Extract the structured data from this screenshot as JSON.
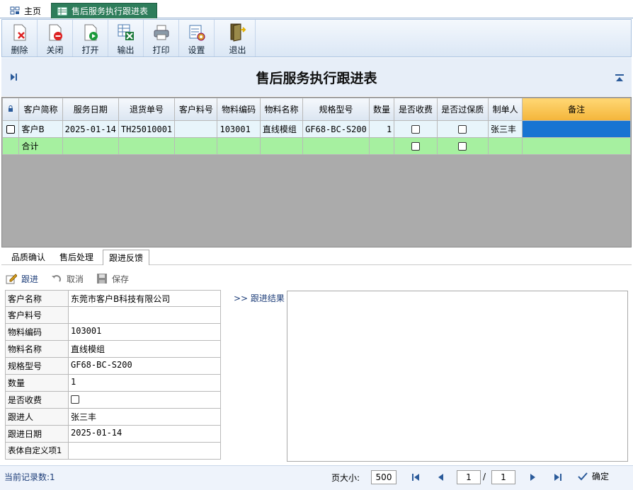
{
  "doc_tabs": {
    "home": "主页",
    "active": "售后服务执行跟进表"
  },
  "toolbar": {
    "delete": "删除",
    "close": "关闭",
    "open": "打开",
    "export": "输出",
    "print": "打印",
    "settings": "设置",
    "exit": "退出"
  },
  "report": {
    "title": "售后服务执行跟进表"
  },
  "grid": {
    "columns": [
      "客户简称",
      "服务日期",
      "退货单号",
      "客户料号",
      "物料编码",
      "物料名称",
      "规格型号",
      "数量",
      "是否收费",
      "是否过保质",
      "制单人",
      "备注"
    ],
    "row": {
      "customer": "客户B",
      "service_date": "2025-01-14",
      "return_no": "TH25010001",
      "customer_part": "",
      "material_code": "103001",
      "material_name": "直线模组",
      "spec": "GF68-BC-S200",
      "qty": "1",
      "maker": "张三丰",
      "remark": ""
    },
    "total_label": "合计"
  },
  "bottom_tabs": [
    "品质确认",
    "售后处理",
    "跟进反馈"
  ],
  "actions": {
    "follow": "跟进",
    "cancel": "取消",
    "save": "保存"
  },
  "form": {
    "customer_name_label": "客户名称",
    "customer_name": "东莞市客户B科技有限公司",
    "customer_part_label": "客户料号",
    "customer_part": "",
    "material_code_label": "物料编码",
    "material_code": "103001",
    "material_name_label": "物料名称",
    "material_name": "直线模组",
    "spec_label": "规格型号",
    "spec": "GF68-BC-S200",
    "qty_label": "数量",
    "qty": "1",
    "charge_label": "是否收费",
    "follower_label": "跟进人",
    "follower": "张三丰",
    "follow_date_label": "跟进日期",
    "follow_date": "2025-01-14",
    "custom1_label": "表体自定义项1",
    "custom1": ""
  },
  "follow_result_label": ">> 跟进结果",
  "status": {
    "record_count": "当前记录数:1",
    "page_size_label": "页大小:",
    "page_size": "500",
    "page": "1",
    "page_sep": "/",
    "total_pages": "1",
    "confirm": "确定"
  }
}
